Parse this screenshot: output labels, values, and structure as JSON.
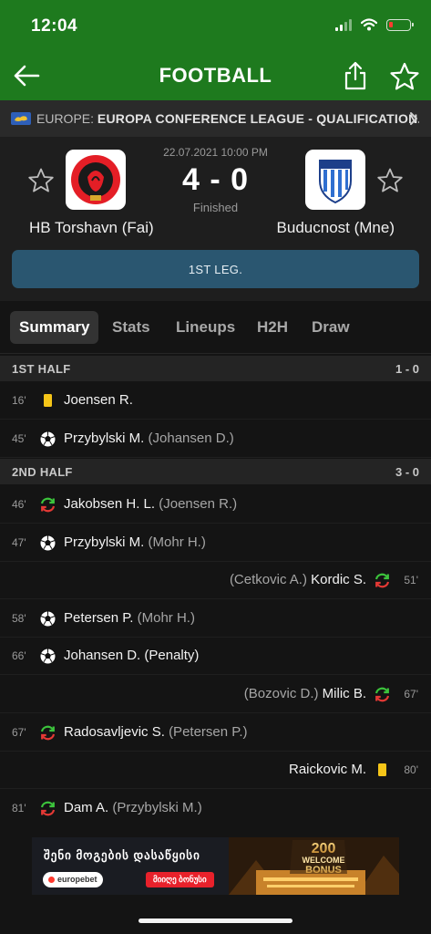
{
  "status_bar": {
    "time": "12:04"
  },
  "nav": {
    "title": "FOOTBALL"
  },
  "competition": {
    "region": "EUROPE:",
    "name": "EUROPA CONFERENCE LEAGUE - QUALIFICATION..."
  },
  "match": {
    "datetime": "22.07.2021 10:00 PM",
    "score": "4 - 0",
    "status": "Finished",
    "home_team": "HB Torshavn (Fai)",
    "away_team": "Buducnost (Mne)",
    "leg": "1ST LEG."
  },
  "tabs": [
    "Summary",
    "Stats",
    "Lineups",
    "H2H",
    "Draw"
  ],
  "periods": [
    {
      "name": "1ST HALF",
      "score": "1 - 0",
      "events": [
        {
          "minute": "16'",
          "side": "home",
          "type": "yellow-card",
          "player": "Joensen R.",
          "assist": ""
        },
        {
          "minute": "45'",
          "side": "home",
          "type": "goal",
          "player": "Przybylski M.",
          "assist": "(Johansen D.)"
        }
      ]
    },
    {
      "name": "2ND HALF",
      "score": "3 - 0",
      "events": [
        {
          "minute": "46'",
          "side": "home",
          "type": "substitution",
          "player": "Jakobsen H. L.",
          "assist": "(Joensen R.)"
        },
        {
          "minute": "47'",
          "side": "home",
          "type": "goal",
          "player": "Przybylski M.",
          "assist": "(Mohr H.)"
        },
        {
          "minute": "51'",
          "side": "away",
          "type": "substitution",
          "player": "Kordic S.",
          "assist": "(Cetkovic A.)"
        },
        {
          "minute": "58'",
          "side": "home",
          "type": "goal",
          "player": "Petersen P.",
          "assist": "(Mohr H.)"
        },
        {
          "minute": "66'",
          "side": "home",
          "type": "goal",
          "player": "Johansen D.",
          "assist": "(Penalty)"
        },
        {
          "minute": "67'",
          "side": "away",
          "type": "substitution",
          "player": "Milic B.",
          "assist": "(Bozovic D.)"
        },
        {
          "minute": "67'",
          "side": "home",
          "type": "substitution",
          "player": "Radosavljevic S.",
          "assist": "(Petersen P.)"
        },
        {
          "minute": "80'",
          "side": "away",
          "type": "yellow-card",
          "player": "Raickovic M.",
          "assist": ""
        },
        {
          "minute": "81'",
          "side": "home",
          "type": "substitution",
          "player": "Dam A.",
          "assist": "(Przybylski M.)"
        }
      ]
    }
  ],
  "ad": {
    "headline": "შენი მოგების დასაწყისი",
    "brand": "europebet",
    "cta": "მიიღე ბონუსი",
    "badge_top": "200",
    "badge_mid": "WELCOME",
    "badge_bottom": "BONUS"
  },
  "colors": {
    "header_green": "#1e7a1e",
    "leg_blue": "#2a5670",
    "yellow_card": "#f5c518",
    "sub_green": "#3cc43c",
    "sub_red": "#e53935"
  }
}
